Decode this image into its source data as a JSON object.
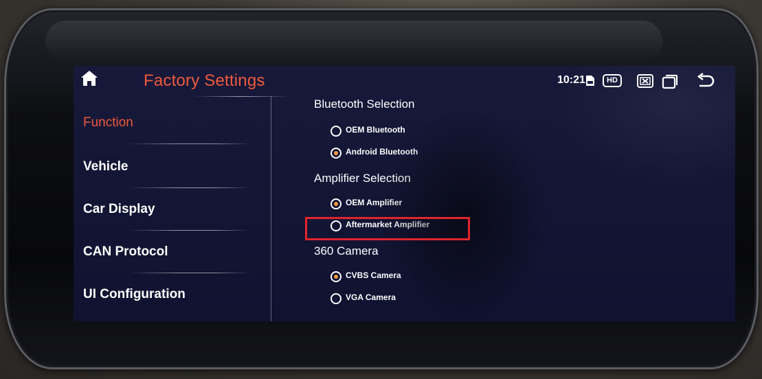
{
  "header": {
    "title": "Factory Settings",
    "time": "10:21",
    "hd_badge": "HD",
    "icons": [
      "home-icon",
      "sd-card-icon",
      "close-app-icon",
      "window-icon",
      "back-icon"
    ]
  },
  "sidebar": {
    "items": [
      {
        "label": "Function",
        "active": true
      },
      {
        "label": "Vehicle",
        "active": false
      },
      {
        "label": "Car Display",
        "active": false
      },
      {
        "label": "CAN Protocol",
        "active": false
      },
      {
        "label": "UI Configuration",
        "active": false
      }
    ]
  },
  "sections": [
    {
      "title": "Bluetooth Selection",
      "options": [
        {
          "label": "OEM Bluetooth",
          "selected": false
        },
        {
          "label": "Android Bluetooth",
          "selected": true
        }
      ]
    },
    {
      "title": "Amplifier Selection",
      "options": [
        {
          "label": "OEM Amplifier",
          "selected": true
        },
        {
          "label": "Aftermarket Amplifier",
          "selected": false
        }
      ]
    },
    {
      "title": "360 Camera",
      "options": [
        {
          "label": "CVBS Camera",
          "selected": true
        },
        {
          "label": "VGA Camera",
          "selected": false
        }
      ]
    }
  ],
  "colors": {
    "accent": "#f05a3a",
    "radio_selected": "#f29a3c",
    "highlight": "#e2242c"
  }
}
